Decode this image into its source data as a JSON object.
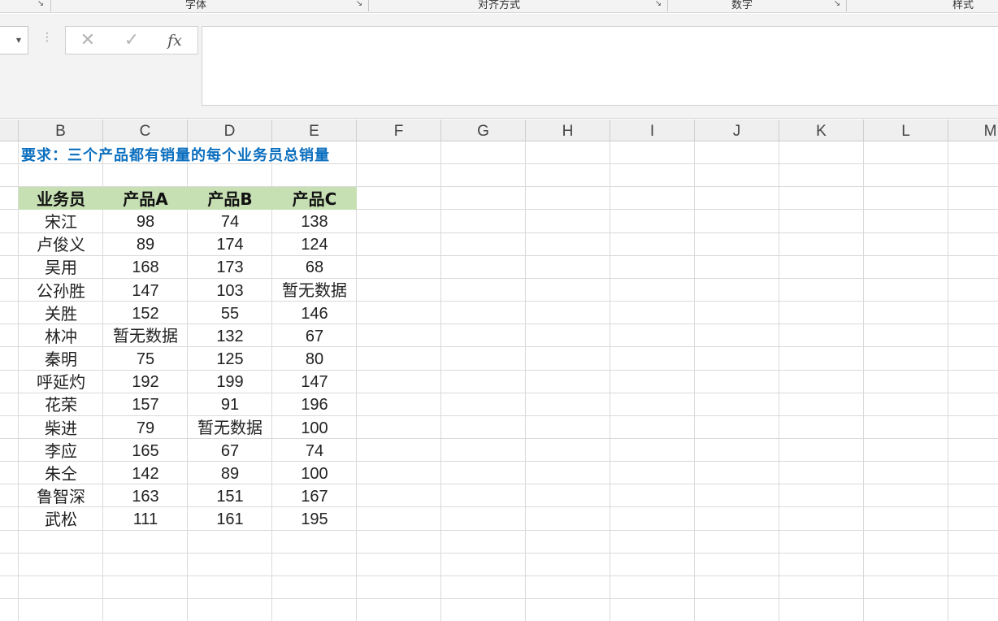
{
  "ribbon": {
    "groups": [
      {
        "label": "字体"
      },
      {
        "label": "对齐方式"
      },
      {
        "label": "数字"
      },
      {
        "label": "样式"
      }
    ]
  },
  "formula_bar": {
    "cancel_icon": "close-icon",
    "enter_icon": "check-icon",
    "fx_label": "fx",
    "value": ""
  },
  "columns": [
    "B",
    "C",
    "D",
    "E",
    "F",
    "G",
    "H",
    "I",
    "J",
    "K",
    "L",
    "M"
  ],
  "sheet": {
    "title": "要求：三个产品都有销量的每个业务员总销量",
    "table": {
      "headers": [
        "业务员",
        "产品A",
        "产品B",
        "产品C"
      ],
      "rows": [
        [
          "宋江",
          "98",
          "74",
          "138"
        ],
        [
          "卢俊义",
          "89",
          "174",
          "124"
        ],
        [
          "吴用",
          "168",
          "173",
          "68"
        ],
        [
          "公孙胜",
          "147",
          "103",
          "暂无数据"
        ],
        [
          "关胜",
          "152",
          "55",
          "146"
        ],
        [
          "林冲",
          "暂无数据",
          "132",
          "67"
        ],
        [
          "秦明",
          "75",
          "125",
          "80"
        ],
        [
          "呼延灼",
          "192",
          "199",
          "147"
        ],
        [
          "花荣",
          "157",
          "91",
          "196"
        ],
        [
          "柴进",
          "79",
          "暂无数据",
          "100"
        ],
        [
          "李应",
          "165",
          "67",
          "74"
        ],
        [
          "朱仝",
          "142",
          "89",
          "100"
        ],
        [
          "鲁智深",
          "163",
          "151",
          "167"
        ],
        [
          "武松",
          "111",
          "161",
          "195"
        ]
      ]
    }
  },
  "colors": {
    "title": "#0b6fbf",
    "header_fill": "#c6e0b4",
    "grid_line": "#dadada"
  }
}
